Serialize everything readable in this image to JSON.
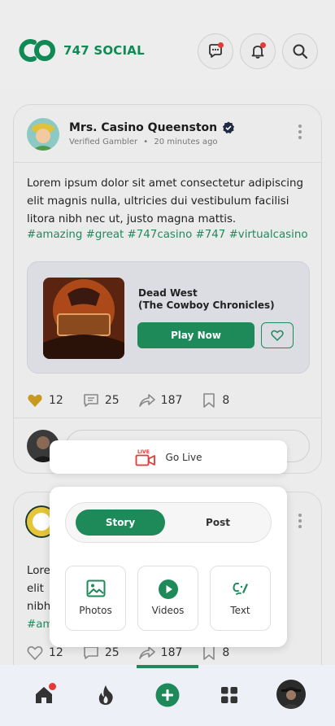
{
  "app": {
    "brand": "747 SOCIAL"
  },
  "post1": {
    "author": "Mrs. Casino Queenston",
    "badge": "Verified Gambler",
    "time": "20 minutes ago",
    "text": "Lorem ipsum dolor sit amet consectetur adipiscing elit magnis nulla, ultricies dui vestibulum facilisi litora nibh nec ut, justo magna mattis.",
    "hashtags": "#amazing #great #747casino #747 #virtualcasino",
    "game_title_line1": "Dead West",
    "game_title_line2": "(The Cowboy Chronicles)",
    "play_label": "Play Now",
    "likes": "12",
    "comments": "25",
    "shares": "187",
    "saves": "8"
  },
  "post2": {
    "text_lines": [
      "Lore",
      "elit",
      "nibh"
    ],
    "tag_fragment": "#am",
    "likes": "12",
    "comments": "25",
    "shares": "187",
    "saves": "8"
  },
  "create_menu": {
    "live_badge": "LIVE",
    "go_live_label": "Go Live",
    "tabs": [
      "Story",
      "Post"
    ],
    "selected_tab": "Story",
    "options": [
      "Photos",
      "Videos",
      "Text"
    ]
  },
  "colors": {
    "accent": "#1e8a5a",
    "notify": "#e53935"
  }
}
